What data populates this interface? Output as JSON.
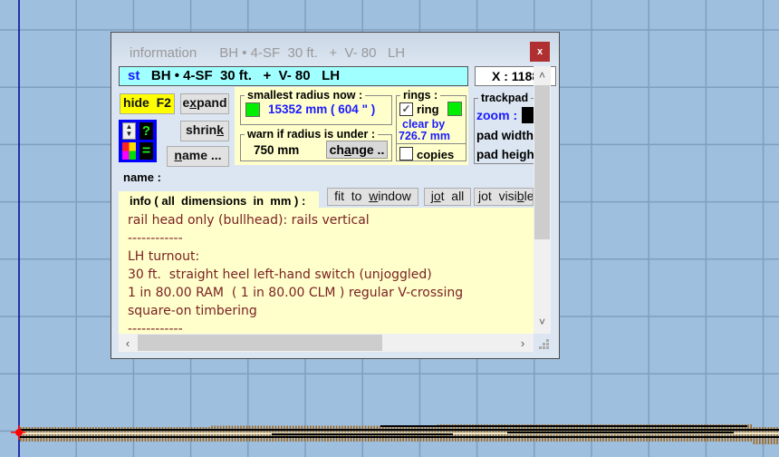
{
  "window": {
    "title_left": "information",
    "title_right": "BH • 4-SF  30 ft.   +  V- 80   LH",
    "close_label": "x"
  },
  "header": {
    "prefix": "st",
    "text": "BH • 4-SF  30 ft.   +  V- 80   LH",
    "x_readout": "X : 1188"
  },
  "buttons": {
    "hide": "hide  F2",
    "expand_pre": "e",
    "expand_u": "x",
    "expand_post": "pand",
    "shrink_pre": "shrin",
    "shrink_u": "k",
    "name_u": "n",
    "name_post": "ame ...",
    "change_pre": "ch",
    "change_u": "a",
    "change_post": "nge ..",
    "fit_pre": "fit  to  ",
    "fit_u": "w",
    "fit_post": "indow",
    "jotall_pre": "j",
    "jotall_u": "o",
    "jotall_post": "t  all",
    "jotvis_pre": "jot  visi",
    "jotvis_u": "b",
    "jotvis_post": "le"
  },
  "tools": {
    "arrows_up": "▲",
    "arrows_down": "▼",
    "help": "?",
    "equals": "="
  },
  "radius": {
    "legend": "smallest  radius  now :",
    "value": "15352 mm ( 604 \" )",
    "status_color": "#00ee00"
  },
  "warn": {
    "legend": "warn  if  radius  is  under :",
    "value": "750 mm"
  },
  "rings": {
    "legend": "rings :",
    "ring_label": "ring",
    "ring_checked": true,
    "clear_by_label": "clear  by",
    "clear_by_value": "726.7 mm",
    "copies_label": "copies",
    "copies_checked": false,
    "status_color": "#00ee00"
  },
  "trackpad": {
    "legend": "trackpad",
    "zoom_label": "zoom :",
    "pad_width_label": "pad  width",
    "pad_height_label": "pad  height"
  },
  "name_label": "name :",
  "info": {
    "title": "info ( all  dimensions  in  mm ) :",
    "lines": [
      "rail head only (bullhead): rails vertical",
      "------------",
      "LH turnout:",
      "30 ft.  straight heel left-hand switch (unjoggled)",
      "1 in 80.00 RAM  ( 1 in 80.00 CLM ) regular V-crossing",
      "square-on timbering",
      "------------"
    ]
  },
  "scroll": {
    "up": "˄",
    "down": "˅",
    "left": "‹",
    "right": "›"
  },
  "colors": {
    "background": "#9fbfdf",
    "grid": "#7f9fbf",
    "axis": "#000099",
    "timber": "#a0661a",
    "rail": "#000000",
    "origin_marker": "#ff0000"
  }
}
